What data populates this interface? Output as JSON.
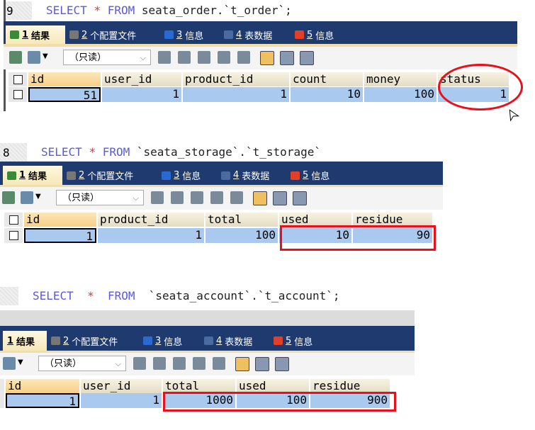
{
  "panels": [
    {
      "line_number": "9",
      "sql": {
        "select": "SELECT",
        "star": "*",
        "from": "FROM",
        "table": "seata_order.`t_order`;"
      },
      "tabs": [
        {
          "num": "1",
          "label": "结果",
          "icon": "result-grid-icon"
        },
        {
          "num": "2",
          "label": "个配置文件",
          "icon": "profile-icon"
        },
        {
          "num": "3",
          "label": "信息",
          "icon": "info-icon"
        },
        {
          "num": "4",
          "label": "表数据",
          "icon": "table-data-icon"
        },
        {
          "num": "5",
          "label": "信息",
          "icon": "info-blocks-icon"
        }
      ],
      "readonly": "（只读）",
      "columns": [
        "id",
        "user_id",
        "product_id",
        "count",
        "money",
        "status"
      ],
      "row": [
        "51",
        "1",
        "1",
        "10",
        "100",
        "1"
      ],
      "highlight": "status"
    },
    {
      "line_number": "8",
      "sql": {
        "select": "SELECT",
        "star": "*",
        "from": "FROM",
        "table": "`seata_storage`.`t_storage`"
      },
      "tabs": [
        {
          "num": "1",
          "label": "结果",
          "icon": "result-grid-icon"
        },
        {
          "num": "2",
          "label": "个配置文件",
          "icon": "profile-icon"
        },
        {
          "num": "3",
          "label": "信息",
          "icon": "info-icon"
        },
        {
          "num": "4",
          "label": "表数据",
          "icon": "table-data-icon"
        },
        {
          "num": "5",
          "label": "信息",
          "icon": "info-blocks-icon"
        }
      ],
      "readonly": "（只读）",
      "columns": [
        "id",
        "product_id",
        "total",
        "used",
        "residue"
      ],
      "row": [
        "1",
        "1",
        "100",
        "10",
        "90"
      ],
      "highlight": "used,residue"
    },
    {
      "line_number": "",
      "sql": {
        "select": "SELECT",
        "star": "*",
        "from": "FROM",
        "table": "`seata_account`.`t_account`;"
      },
      "tabs": [
        {
          "num": "1",
          "label": "结果",
          "icon": "result-grid-icon"
        },
        {
          "num": "2",
          "label": "个配置文件",
          "icon": "profile-icon"
        },
        {
          "num": "3",
          "label": "信息",
          "icon": "info-icon"
        },
        {
          "num": "4",
          "label": "表数据",
          "icon": "table-data-icon"
        },
        {
          "num": "5",
          "label": "信息",
          "icon": "info-blocks-icon"
        }
      ],
      "readonly": "（只读）",
      "columns": [
        "id",
        "user_id",
        "total",
        "used",
        "residue"
      ],
      "row": [
        "1",
        "1",
        "1000",
        "100",
        "900"
      ],
      "highlight": "total,used,residue"
    }
  ],
  "colors": {
    "highlight": "#e8101a",
    "cell": "#a9c9ee",
    "tabbar": "#1e3a6e"
  }
}
